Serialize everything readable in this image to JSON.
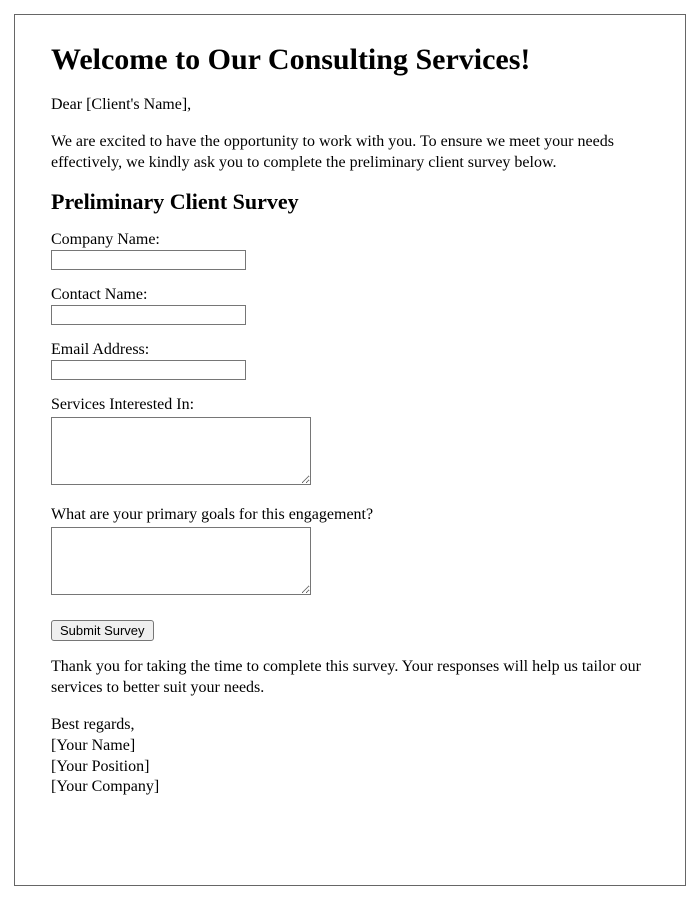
{
  "header": {
    "title": "Welcome to Our Consulting Services!"
  },
  "greeting": "Dear [Client's Name],",
  "intro": "We are excited to have the opportunity to work with you. To ensure we meet your needs effectively, we kindly ask you to complete the preliminary client survey below.",
  "survey": {
    "heading": "Preliminary Client Survey",
    "fields": {
      "company_name_label": "Company Name:",
      "contact_name_label": "Contact Name:",
      "email_label": "Email Address:",
      "services_label": "Services Interested In:",
      "goals_label": "What are your primary goals for this engagement?"
    },
    "submit_label": "Submit Survey"
  },
  "thanks": "Thank you for taking the time to complete this survey. Your responses will help us tailor our services to better suit your needs.",
  "signoff": {
    "regards": "Best regards,",
    "name": "[Your Name]",
    "position": "[Your Position]",
    "company": "[Your Company]"
  }
}
